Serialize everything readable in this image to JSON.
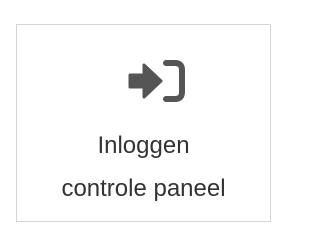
{
  "login_tile": {
    "icon": "sign-in-icon",
    "label_line1": "Inloggen",
    "label_line2": "controle paneel",
    "icon_color": "#555555",
    "text_color": "#333333",
    "border_color": "#d4d4d4"
  }
}
